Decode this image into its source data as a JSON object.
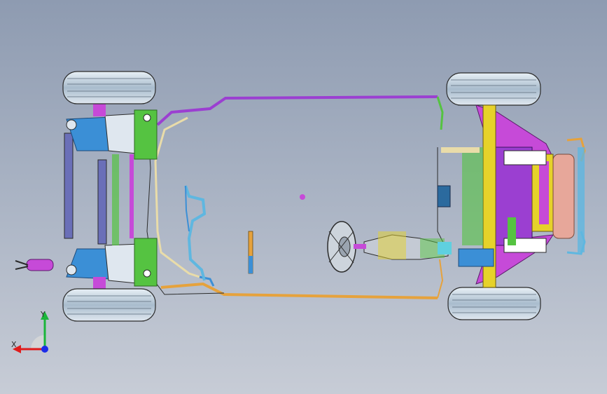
{
  "viewport": {
    "background_top": "#8e9bb1",
    "background_bottom": "#c7ccd6",
    "model": "vehicle-chassis-top-view"
  },
  "triad": {
    "x_label": "X",
    "y_label": "Y",
    "x_color": "#e01b1b",
    "y_color": "#1bb53a",
    "z_color": "#1c2ce8"
  },
  "colors": {
    "tire": "#b8c8d8",
    "frame_blue": "#3b8fd6",
    "frame_cyan": "#5fd0e0",
    "green": "#55c341",
    "magenta": "#c64ad8",
    "purple_pipe": "#9b3fd1",
    "orange_pipe": "#e6a23c",
    "cream_line": "#e9dca9",
    "yellow": "#e6d22a",
    "dark": "#2b2b2b"
  }
}
